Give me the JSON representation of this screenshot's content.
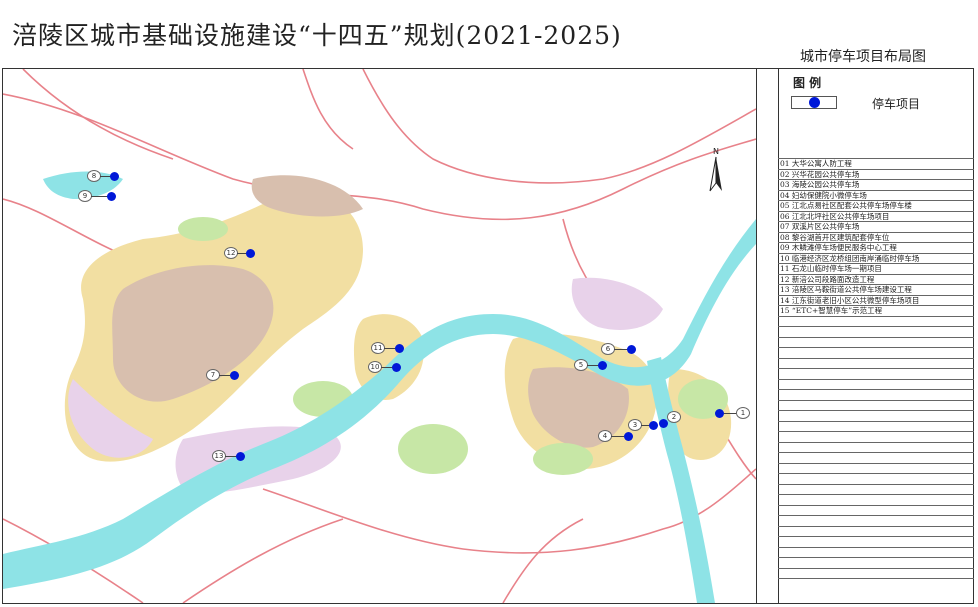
{
  "header": {
    "title": "涪陵区城市基础设施建设“十四五”规划(2021-2025)",
    "subtitle": "城市停车项目布局图"
  },
  "legend": {
    "title": "图 例",
    "item_label": "停车项目",
    "pin_color": "#0018d8"
  },
  "compass": {
    "label": "N"
  },
  "projects": [
    "01  大华公寓人防工程",
    "02  兴华花园公共停车场",
    "03  海陵公园公共停车场",
    "04  妇幼保健院小微停车场",
    "05  江北点易社区配套公共停车场停车楼",
    "06  江北北坪社区公共停车场项目",
    "07  双溪片区公共停车场",
    "08  黎谷湖首开区建筑配套停车位",
    "09  木鳞滩停车场便民服务中心工程",
    "10  临港经济区龙桥组团南岸涌临时停车场",
    "11  石龙山临时停车场一期项目",
    "12  新涪公司段路面改造工程",
    "13  涪陵区马鞍街道公共停车场建设工程",
    "14  江东街道老旧小区公共微型停车场项目",
    "15  “ETC+智慧停车”示范工程"
  ],
  "map_markers": [
    "1",
    "2",
    "3",
    "4",
    "5",
    "6",
    "7",
    "8",
    "9",
    "10",
    "11",
    "12",
    "13"
  ],
  "colors": {
    "river": "#8ee3e6",
    "road": "#e8828a",
    "urban_a": "#f2dfa2",
    "urban_b": "#d8bfae",
    "urban_c": "#e8d2ea",
    "green": "#c7e7a6"
  }
}
